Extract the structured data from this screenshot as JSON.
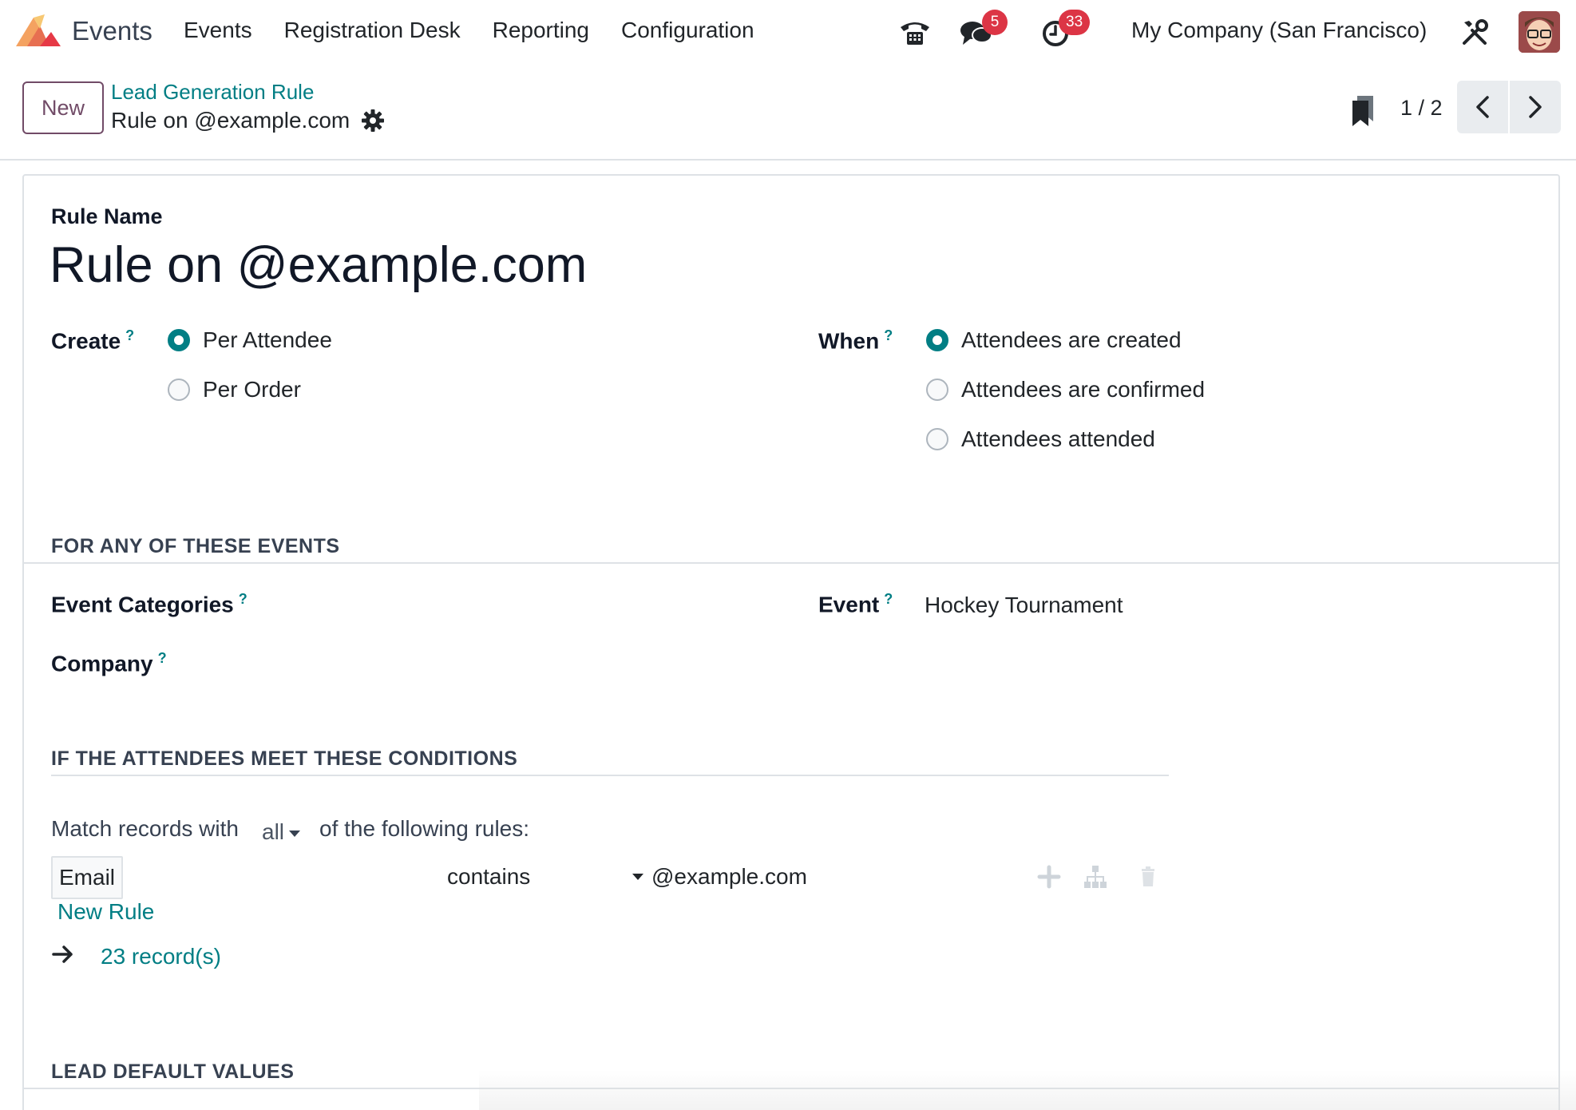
{
  "navbar": {
    "app_name": "Events",
    "menu": [
      "Events",
      "Registration Desk",
      "Reporting",
      "Configuration"
    ],
    "messages_count": "5",
    "activities_count": "33",
    "company": "My Company (San Francisco)"
  },
  "control": {
    "new_label": "New",
    "breadcrumb_parent": "Lead Generation Rule",
    "breadcrumb_current": "Rule on @example.com",
    "pager": "1 / 2"
  },
  "form": {
    "rule_name_label": "Rule Name",
    "rule_name": "Rule on @example.com",
    "create_label": "Create",
    "create_tip": "?",
    "create_options": [
      "Per Attendee",
      "Per Order"
    ],
    "create_selected": "Per Attendee",
    "when_label": "When",
    "when_tip": "?",
    "when_options": [
      "Attendees are created",
      "Attendees are confirmed",
      "Attendees attended"
    ],
    "when_selected": "Attendees are created",
    "section_events": "FOR ANY OF THESE EVENTS",
    "event_categories_label": "Event Categories",
    "event_categories_tip": "?",
    "event_label": "Event",
    "event_tip": "?",
    "event_value": "Hockey Tournament",
    "company_label": "Company",
    "company_tip": "?",
    "section_conditions": "IF THE ATTENDEES MEET THESE CONDITIONS",
    "match_prefix": "Match records with",
    "match_mode": "all",
    "match_suffix": "of the following rules:",
    "rule": {
      "field": "Email",
      "operator": "contains",
      "value": "@example.com"
    },
    "new_rule_label": "New Rule",
    "records_count": "23 record(s)",
    "section_defaults": "LEAD DEFAULT VALUES"
  },
  "colors": {
    "accent": "#017e84",
    "brand": "#714b67",
    "badge": "#dc3545"
  }
}
